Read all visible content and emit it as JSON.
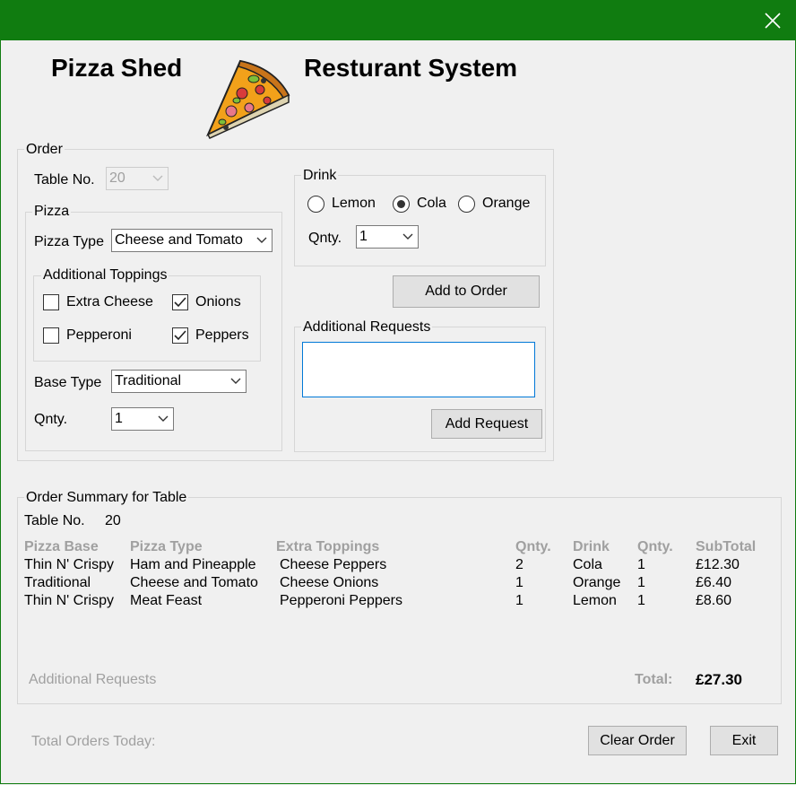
{
  "window": {
    "close_glyph": "✕"
  },
  "header": {
    "left_title": "Pizza Shed",
    "right_title": "Resturant System",
    "logo_icon": "pizza-slice"
  },
  "order": {
    "legend": "Order",
    "table_no": {
      "label": "Table No.",
      "value": "20"
    },
    "pizza": {
      "legend": "Pizza",
      "type_label": "Pizza Type",
      "type_value": "Cheese and Tomato",
      "toppings": {
        "legend": "Additional Toppings",
        "items": [
          {
            "label": "Extra Cheese",
            "checked": false
          },
          {
            "label": "Onions",
            "checked": true
          },
          {
            "label": "Pepperoni",
            "checked": false
          },
          {
            "label": "Peppers",
            "checked": true
          }
        ]
      },
      "base_label": "Base Type",
      "base_value": "Traditional",
      "qnty_label": "Qnty.",
      "qnty_value": "1"
    },
    "drink": {
      "legend": "Drink",
      "options": [
        {
          "label": "Lemon",
          "selected": false
        },
        {
          "label": "Cola",
          "selected": true
        },
        {
          "label": "Orange",
          "selected": false
        }
      ],
      "qnty_label": "Qnty.",
      "qnty_value": "1"
    },
    "add_to_order_label": "Add to Order",
    "requests": {
      "legend": "Additional Requests",
      "text": "",
      "add_label": "Add Request"
    }
  },
  "summary": {
    "legend": "Order Summary for Table",
    "table_label": "Table No.",
    "table_value": "20",
    "columns": [
      "Pizza Base",
      "Pizza Type",
      "Extra Toppings",
      "Qnty.",
      "Drink",
      "Qnty.",
      "SubTotal"
    ],
    "rows": [
      [
        "Thin N' Crispy",
        "Ham and Pineapple",
        "Cheese Peppers",
        "2",
        "Cola",
        "1",
        "£12.30"
      ],
      [
        "Traditional",
        "Cheese and Tomato",
        "Cheese Onions",
        "1",
        "Orange",
        "1",
        "£6.40"
      ],
      [
        "Thin N' Crispy",
        "Meat Feast",
        "Pepperoni Peppers",
        "1",
        "Lemon",
        "1",
        "£8.60"
      ]
    ],
    "additional_requests_label": "Additional Requests",
    "total_label": "Total:",
    "total_value": "£27.30"
  },
  "footer": {
    "orders_today_label": "Total Orders Today:",
    "clear_label": "Clear Order",
    "exit_label": "Exit"
  },
  "colors": {
    "titlebar": "#107c10",
    "background": "#f0f0f0",
    "muted_text": "#a0a0a0",
    "focus_border": "#0078d7"
  }
}
